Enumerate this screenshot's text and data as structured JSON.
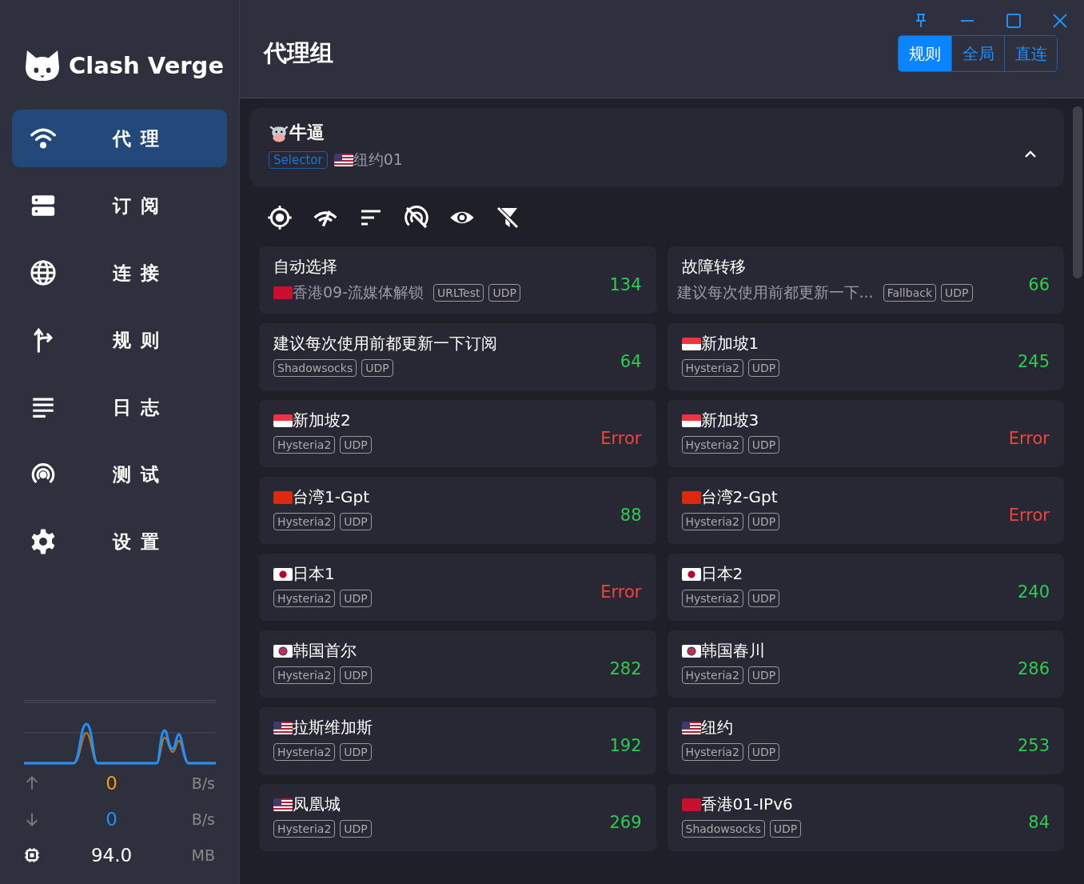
{
  "app": {
    "name": "Clash Verge"
  },
  "nav": [
    {
      "label": "代 理",
      "selected": true
    },
    {
      "label": "订 阅",
      "selected": false
    },
    {
      "label": "连 接",
      "selected": false
    },
    {
      "label": "规 则",
      "selected": false
    },
    {
      "label": "日 志",
      "selected": false
    },
    {
      "label": "测 试",
      "selected": false
    },
    {
      "label": "设 置",
      "selected": false
    }
  ],
  "traffic": {
    "upload": "0",
    "upload_unit": "B/s",
    "download": "0",
    "download_unit": "B/s",
    "memory": "94.0",
    "memory_unit": "MB"
  },
  "page_title": "代理组",
  "modes": [
    {
      "label": "规则",
      "selected": true
    },
    {
      "label": "全局",
      "selected": false
    },
    {
      "label": "直连",
      "selected": false
    }
  ],
  "group": {
    "name": "牛逼",
    "type": "Selector",
    "current": "纽约01",
    "expanded": true
  },
  "proxies": [
    {
      "name": "自动选择",
      "sub": "香港09-流媒体解锁",
      "tags": [
        "URLTest",
        "UDP"
      ],
      "delay": "134",
      "color": "#2ecc4f"
    },
    {
      "name": "故障转移",
      "sub": "建议每次使用前都更新一下...",
      "tags": [
        "Fallback",
        "UDP"
      ],
      "delay": "66",
      "color": "#2ecc4f"
    },
    {
      "name": "建议每次使用前都更新一下订阅",
      "tags": [
        "Shadowsocks",
        "UDP"
      ],
      "delay": "64",
      "color": "#2ecc4f"
    },
    {
      "name": "新加坡1",
      "tags": [
        "Hysteria2",
        "UDP"
      ],
      "delay": "245",
      "color": "#2ecc4f"
    },
    {
      "name": "新加坡2",
      "tags": [
        "Hysteria2",
        "UDP"
      ],
      "delay": "Error",
      "color": "#f0453a"
    },
    {
      "name": "新加坡3",
      "tags": [
        "Hysteria2",
        "UDP"
      ],
      "delay": "Error",
      "color": "#f0453a"
    },
    {
      "name": "台湾1-Gpt",
      "tags": [
        "Hysteria2",
        "UDP"
      ],
      "delay": "88",
      "color": "#2ecc4f"
    },
    {
      "name": "台湾2-Gpt",
      "tags": [
        "Hysteria2",
        "UDP"
      ],
      "delay": "Error",
      "color": "#f0453a"
    },
    {
      "name": "日本1",
      "tags": [
        "Hysteria2",
        "UDP"
      ],
      "delay": "Error",
      "color": "#f0453a"
    },
    {
      "name": "日本2",
      "tags": [
        "Hysteria2",
        "UDP"
      ],
      "delay": "240",
      "color": "#2ecc4f"
    },
    {
      "name": "韩国首尔",
      "tags": [
        "Hysteria2",
        "UDP"
      ],
      "delay": "282",
      "color": "#2ecc4f"
    },
    {
      "name": "韩国春川",
      "tags": [
        "Hysteria2",
        "UDP"
      ],
      "delay": "286",
      "color": "#2ecc4f"
    },
    {
      "name": "拉斯维加斯",
      "tags": [
        "Hysteria2",
        "UDP"
      ],
      "delay": "192",
      "color": "#2ecc4f"
    },
    {
      "name": "纽约",
      "tags": [
        "Hysteria2",
        "UDP"
      ],
      "delay": "253",
      "color": "#2ecc4f"
    },
    {
      "name": "凤凰城",
      "tags": [
        "Hysteria2",
        "UDP"
      ],
      "delay": "269",
      "color": "#2ecc4f"
    },
    {
      "name": "香港01-IPv6",
      "tags": [
        "Shadowsocks",
        "UDP"
      ],
      "delay": "84",
      "color": "#2ecc4f"
    }
  ]
}
